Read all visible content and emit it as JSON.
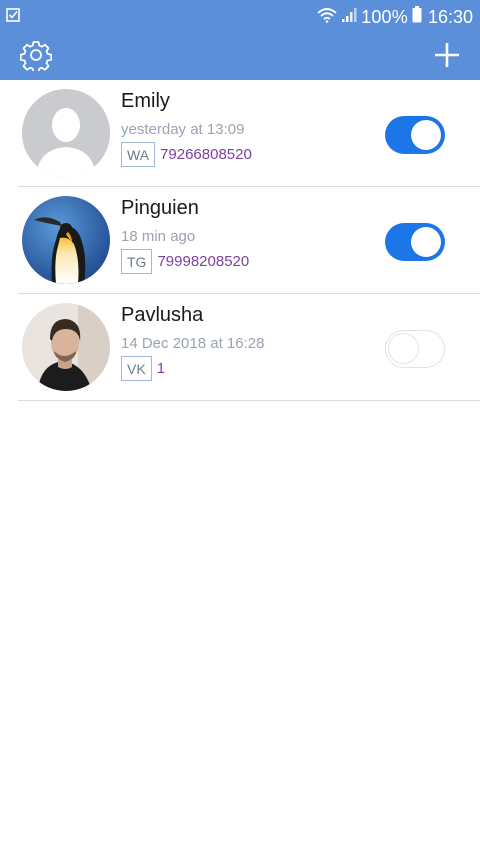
{
  "status_bar": {
    "battery_percent": "100%",
    "time": "16:30",
    "left_icon": "checkbox-notification-icon",
    "wifi_icon": "wifi-icon",
    "signal_icon": "signal-icon",
    "battery_icon": "battery-icon"
  },
  "app_bar": {
    "settings_icon": "gear-icon",
    "add_icon": "plus-icon",
    "color": "#5b8fd9"
  },
  "contacts": [
    {
      "name": "Emily",
      "last_seen": "yesterday at 13:09",
      "service": "WA",
      "number": "79266808520",
      "enabled": true,
      "avatar": "placeholder-avatar"
    },
    {
      "name": "Pinguien",
      "last_seen": "18 min ago",
      "service": "TG",
      "number": "79998208520",
      "enabled": true,
      "avatar": "penguin-photo"
    },
    {
      "name": "Pavlusha",
      "last_seen": "14 Dec 2018 at 16:28",
      "service": "VK",
      "number": "1",
      "enabled": false,
      "avatar": "man-photo"
    }
  ],
  "colors": {
    "toggle_on": "#1d76e8",
    "number_text": "#7b3fa0",
    "timestamp_text": "#9aa3b3"
  }
}
